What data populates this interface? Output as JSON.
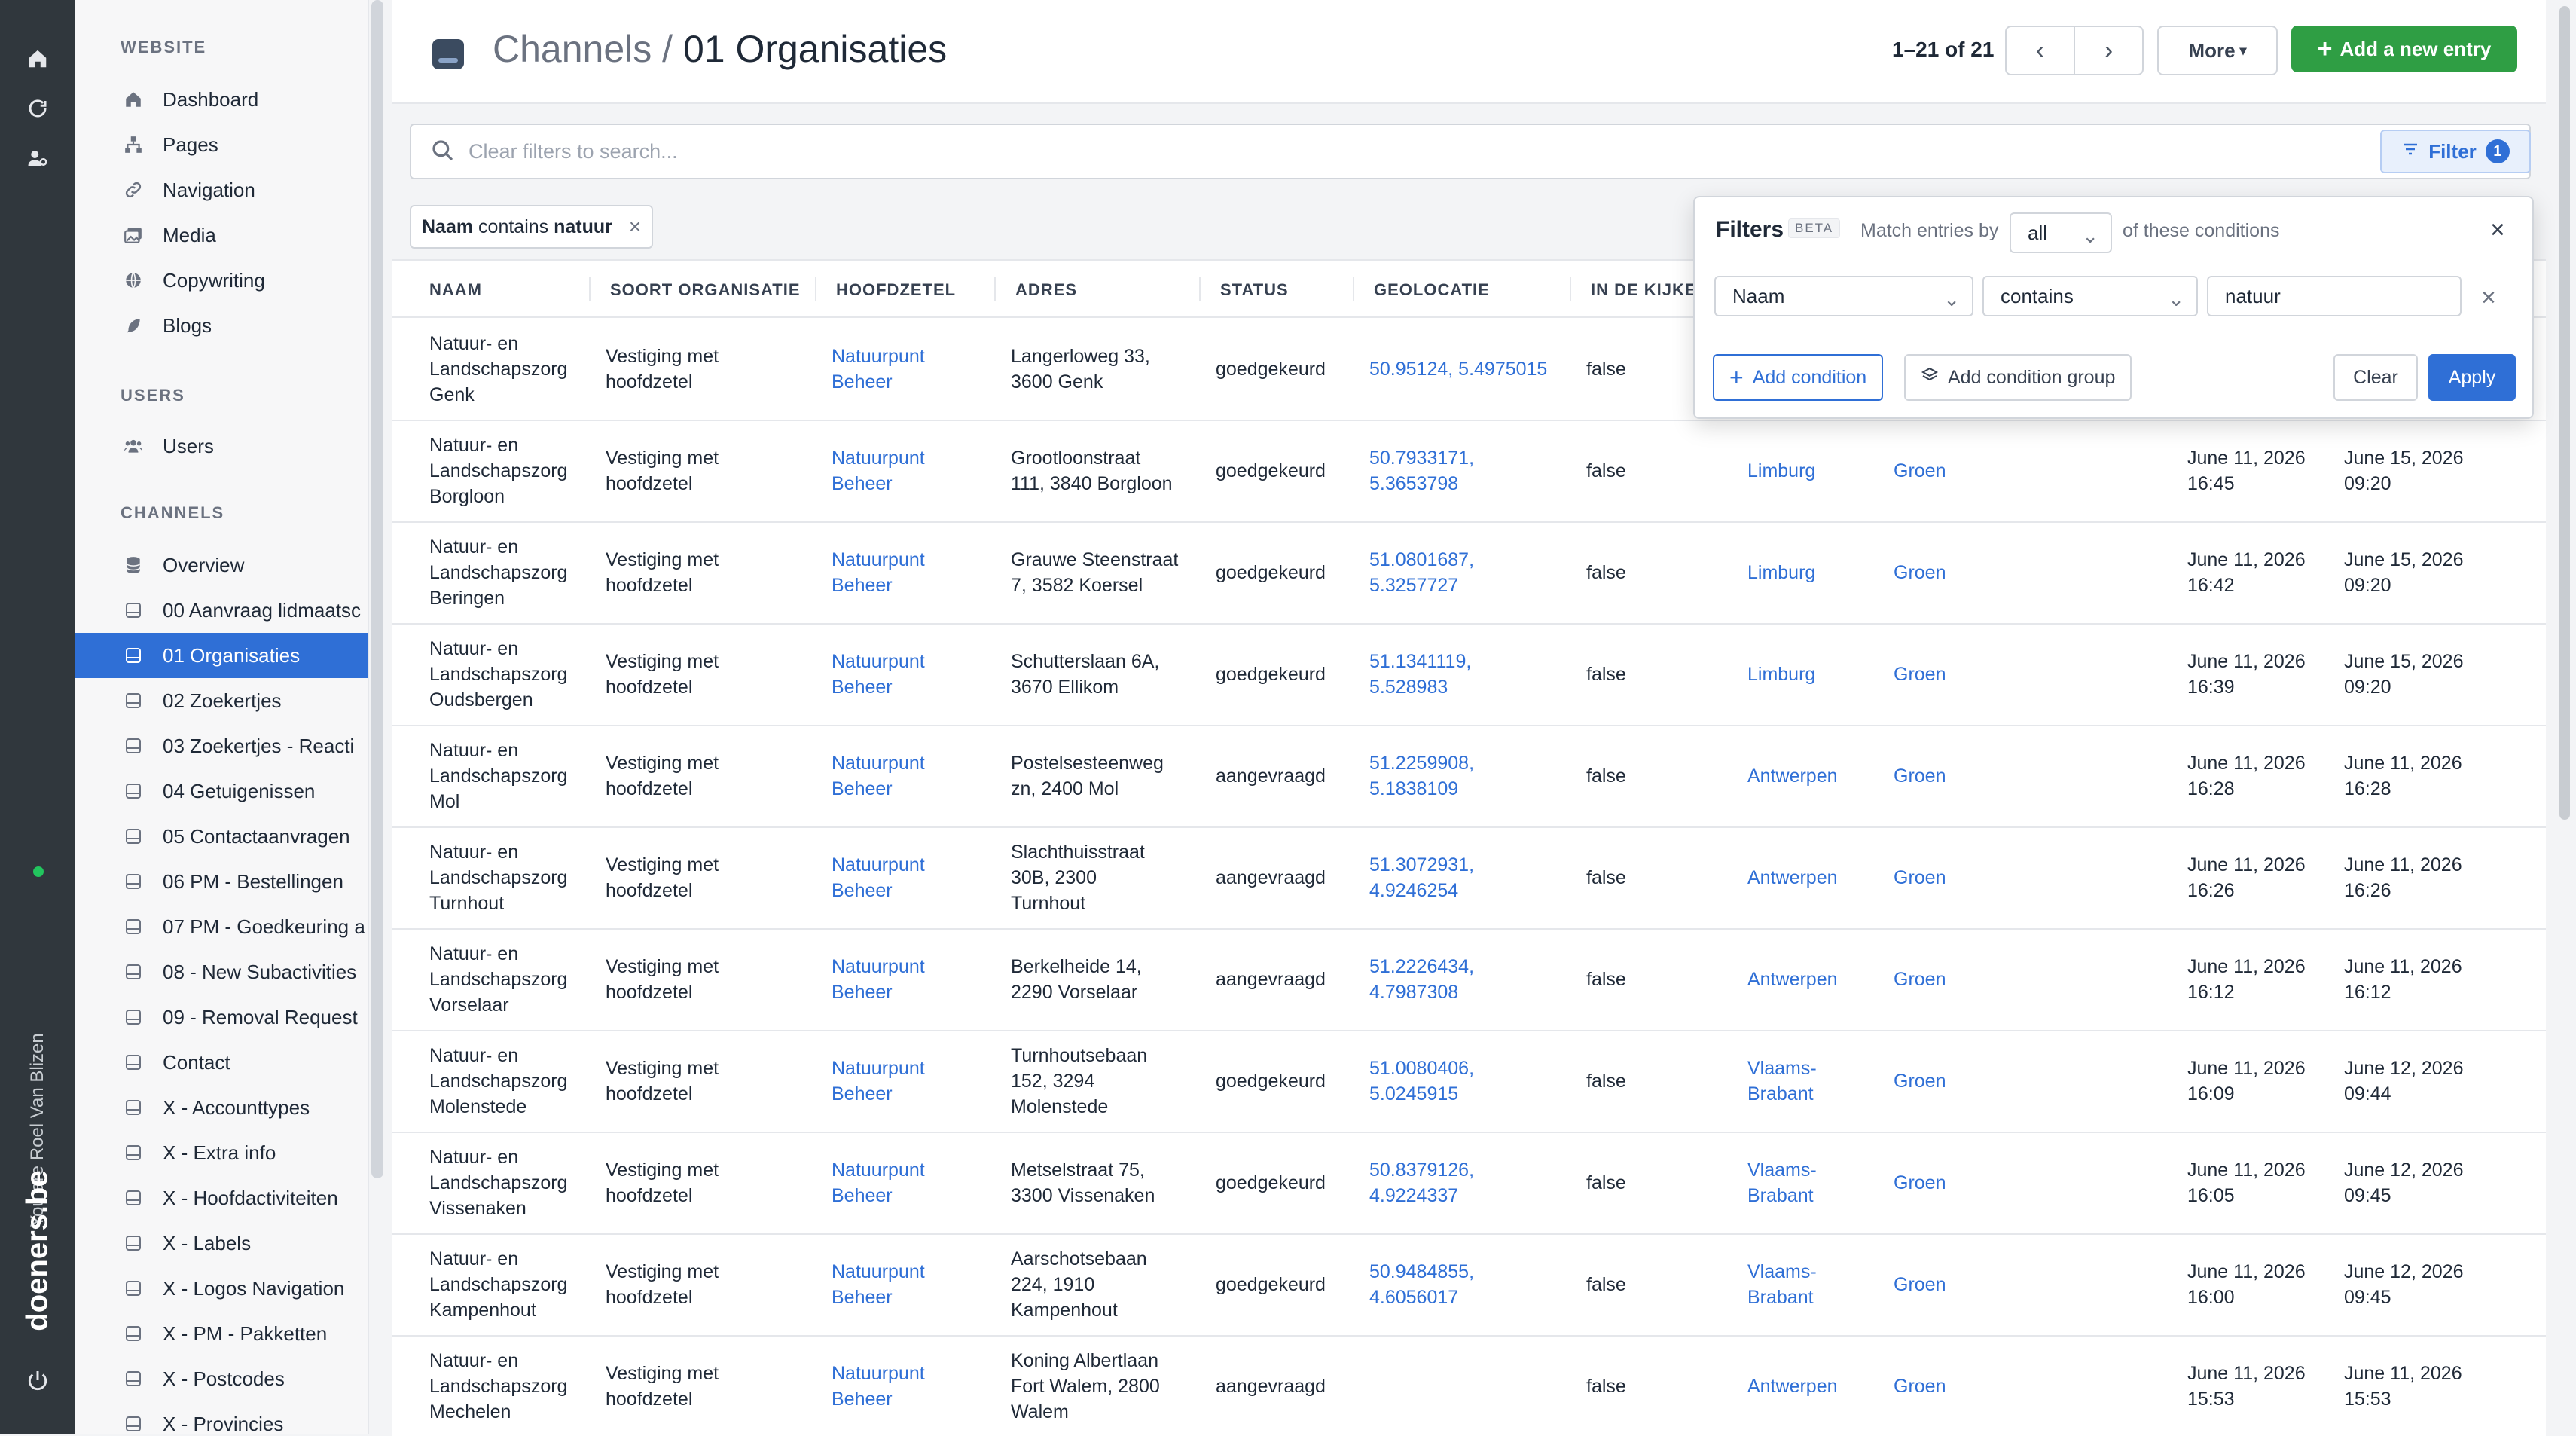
{
  "rail": {
    "user_text": "You are Roel Van Blizen",
    "brand": "doeners.be"
  },
  "sidebar": {
    "sections": [
      {
        "title": "WEBSITE",
        "items": [
          {
            "label": "Dashboard",
            "icon": "home-icon"
          },
          {
            "label": "Pages",
            "icon": "sitemap-icon"
          },
          {
            "label": "Navigation",
            "icon": "link-icon"
          },
          {
            "label": "Media",
            "icon": "images-icon"
          },
          {
            "label": "Copywriting",
            "icon": "globe-icon"
          },
          {
            "label": "Blogs",
            "icon": "feather-icon"
          }
        ]
      },
      {
        "title": "USERS",
        "items": [
          {
            "label": "Users",
            "icon": "users-icon"
          }
        ]
      },
      {
        "title": "CHANNELS",
        "items": [
          {
            "label": "Overview",
            "icon": "database-icon"
          },
          {
            "label": "00 Aanvraag lidmaatsc",
            "icon": "channel-icon"
          },
          {
            "label": "01 Organisaties",
            "icon": "channel-icon",
            "active": true
          },
          {
            "label": "02 Zoekertjes",
            "icon": "channel-icon"
          },
          {
            "label": "03 Zoekertjes - Reacti",
            "icon": "channel-icon"
          },
          {
            "label": "04 Getuigenissen",
            "icon": "channel-icon"
          },
          {
            "label": "05 Contactaanvragen",
            "icon": "channel-icon"
          },
          {
            "label": "06 PM - Bestellingen",
            "icon": "channel-icon"
          },
          {
            "label": "07 PM - Goedkeuring a",
            "icon": "channel-icon"
          },
          {
            "label": "08 - New Subactivities",
            "icon": "channel-icon"
          },
          {
            "label": "09 - Removal Request",
            "icon": "channel-icon"
          },
          {
            "label": "Contact",
            "icon": "channel-icon"
          },
          {
            "label": "X - Accounttypes",
            "icon": "channel-icon"
          },
          {
            "label": "X - Extra info",
            "icon": "channel-icon"
          },
          {
            "label": "X - Hoofdactiviteiten",
            "icon": "channel-icon"
          },
          {
            "label": "X - Labels",
            "icon": "channel-icon"
          },
          {
            "label": "X - Logos Navigation",
            "icon": "channel-icon"
          },
          {
            "label": "X - PM - Pakketten",
            "icon": "channel-icon"
          },
          {
            "label": "X - Postcodes",
            "icon": "channel-icon"
          },
          {
            "label": "X - Provincies",
            "icon": "channel-icon"
          }
        ]
      }
    ]
  },
  "header": {
    "crumb": "Channels",
    "sep": " / ",
    "title": "01 Organisaties",
    "pager_count": "1–21 of 21",
    "more_label": "More",
    "add_label": "Add a new entry"
  },
  "search": {
    "placeholder": "Clear filters to search...",
    "filter_label": "Filter",
    "filter_count": "1"
  },
  "chip": {
    "field": "Naam",
    "op": " contains ",
    "value": "natuur"
  },
  "filters": {
    "title": "Filters",
    "beta": "BETA",
    "match_label": "Match entries by",
    "match_value": "all",
    "of_label": "of these conditions",
    "condition": {
      "field": "Naam",
      "operator": "contains",
      "value": "natuur"
    },
    "add_condition": "Add condition",
    "add_group": "Add condition group",
    "clear": "Clear",
    "apply": "Apply"
  },
  "table": {
    "columns": [
      "NAAM",
      "SOORT ORGANISATIE",
      "HOOFDZETEL",
      "ADRES",
      "STATUS",
      "GEOLOCATIE",
      "IN DE KIJKER"
    ],
    "rows": [
      {
        "naam": [
          "Natuur- en",
          "Landschapszorg",
          "Genk"
        ],
        "soort": [
          "Vestiging met",
          "hoofdzetel"
        ],
        "hoofdzetel": [
          "Natuurpunt",
          "Beheer"
        ],
        "adres": [
          "Langerloweg 33,",
          "3600 Genk"
        ],
        "status": "goedgekeurd",
        "geo": [
          "50.95124, 5.4975015"
        ],
        "kijker": "false",
        "provincie": [],
        "thema": "",
        "d1": [],
        "d2": []
      },
      {
        "naam": [
          "Natuur- en",
          "Landschapszorg",
          "Borgloon"
        ],
        "soort": [
          "Vestiging met",
          "hoofdzetel"
        ],
        "hoofdzetel": [
          "Natuurpunt",
          "Beheer"
        ],
        "adres": [
          "Grootloonstraat",
          "111, 3840 Borgloon"
        ],
        "status": "goedgekeurd",
        "geo": [
          "50.7933171,",
          "5.3653798"
        ],
        "kijker": "false",
        "provincie": [
          "Limburg"
        ],
        "thema": "Groen",
        "d1": [
          "June 11, 2026",
          "16:45"
        ],
        "d2": [
          "June 15, 2026",
          "09:20"
        ]
      },
      {
        "naam": [
          "Natuur- en",
          "Landschapszorg",
          "Beringen"
        ],
        "soort": [
          "Vestiging met",
          "hoofdzetel"
        ],
        "hoofdzetel": [
          "Natuurpunt",
          "Beheer"
        ],
        "adres": [
          "Grauwe Steenstraat",
          "7, 3582 Koersel"
        ],
        "status": "goedgekeurd",
        "geo": [
          "51.0801687,",
          "5.3257727"
        ],
        "kijker": "false",
        "provincie": [
          "Limburg"
        ],
        "thema": "Groen",
        "d1": [
          "June 11, 2026",
          "16:42"
        ],
        "d2": [
          "June 15, 2026",
          "09:20"
        ]
      },
      {
        "naam": [
          "Natuur- en",
          "Landschapszorg",
          "Oudsbergen"
        ],
        "soort": [
          "Vestiging met",
          "hoofdzetel"
        ],
        "hoofdzetel": [
          "Natuurpunt",
          "Beheer"
        ],
        "adres": [
          "Schutterslaan 6A,",
          "3670 Ellikom"
        ],
        "status": "goedgekeurd",
        "geo": [
          "51.1341119,",
          "5.528983"
        ],
        "kijker": "false",
        "provincie": [
          "Limburg"
        ],
        "thema": "Groen",
        "d1": [
          "June 11, 2026",
          "16:39"
        ],
        "d2": [
          "June 15, 2026",
          "09:20"
        ]
      },
      {
        "naam": [
          "Natuur- en",
          "Landschapszorg",
          "Mol"
        ],
        "soort": [
          "Vestiging met",
          "hoofdzetel"
        ],
        "hoofdzetel": [
          "Natuurpunt",
          "Beheer"
        ],
        "adres": [
          "Postelsesteenweg",
          "zn, 2400 Mol"
        ],
        "status": "aangevraagd",
        "geo": [
          "51.2259908,",
          "5.1838109"
        ],
        "kijker": "false",
        "provincie": [
          "Antwerpen"
        ],
        "thema": "Groen",
        "d1": [
          "June 11, 2026",
          "16:28"
        ],
        "d2": [
          "June 11, 2026",
          "16:28"
        ]
      },
      {
        "naam": [
          "Natuur- en",
          "Landschapszorg",
          "Turnhout"
        ],
        "soort": [
          "Vestiging met",
          "hoofdzetel"
        ],
        "hoofdzetel": [
          "Natuurpunt",
          "Beheer"
        ],
        "adres": [
          "Slachthuisstraat",
          "30B, 2300",
          "Turnhout"
        ],
        "status": "aangevraagd",
        "geo": [
          "51.3072931,",
          "4.9246254"
        ],
        "kijker": "false",
        "provincie": [
          "Antwerpen"
        ],
        "thema": "Groen",
        "d1": [
          "June 11, 2026",
          "16:26"
        ],
        "d2": [
          "June 11, 2026",
          "16:26"
        ]
      },
      {
        "naam": [
          "Natuur- en",
          "Landschapszorg",
          "Vorselaar"
        ],
        "soort": [
          "Vestiging met",
          "hoofdzetel"
        ],
        "hoofdzetel": [
          "Natuurpunt",
          "Beheer"
        ],
        "adres": [
          "Berkelheide 14,",
          "2290 Vorselaar"
        ],
        "status": "aangevraagd",
        "geo": [
          "51.2226434,",
          "4.7987308"
        ],
        "kijker": "false",
        "provincie": [
          "Antwerpen"
        ],
        "thema": "Groen",
        "d1": [
          "June 11, 2026",
          "16:12"
        ],
        "d2": [
          "June 11, 2026",
          "16:12"
        ]
      },
      {
        "naam": [
          "Natuur- en",
          "Landschapszorg",
          "Molenstede"
        ],
        "soort": [
          "Vestiging met",
          "hoofdzetel"
        ],
        "hoofdzetel": [
          "Natuurpunt",
          "Beheer"
        ],
        "adres": [
          "Turnhoutsebaan",
          "152, 3294",
          "Molenstede"
        ],
        "status": "goedgekeurd",
        "geo": [
          "51.0080406,",
          "5.0245915"
        ],
        "kijker": "false",
        "provincie": [
          "Vlaams-",
          "Brabant"
        ],
        "thema": "Groen",
        "d1": [
          "June 11, 2026",
          "16:09"
        ],
        "d2": [
          "June 12, 2026",
          "09:44"
        ]
      },
      {
        "naam": [
          "Natuur- en",
          "Landschapszorg",
          "Vissenaken"
        ],
        "soort": [
          "Vestiging met",
          "hoofdzetel"
        ],
        "hoofdzetel": [
          "Natuurpunt",
          "Beheer"
        ],
        "adres": [
          "Metselstraat 75,",
          "3300 Vissenaken"
        ],
        "status": "goedgekeurd",
        "geo": [
          "50.8379126,",
          "4.9224337"
        ],
        "kijker": "false",
        "provincie": [
          "Vlaams-",
          "Brabant"
        ],
        "thema": "Groen",
        "d1": [
          "June 11, 2026",
          "16:05"
        ],
        "d2": [
          "June 12, 2026",
          "09:45"
        ]
      },
      {
        "naam": [
          "Natuur- en",
          "Landschapszorg",
          "Kampenhout"
        ],
        "soort": [
          "Vestiging met",
          "hoofdzetel"
        ],
        "hoofdzetel": [
          "Natuurpunt",
          "Beheer"
        ],
        "adres": [
          "Aarschotsebaan",
          "224, 1910",
          "Kampenhout"
        ],
        "status": "goedgekeurd",
        "geo": [
          "50.9484855,",
          "4.6056017"
        ],
        "kijker": "false",
        "provincie": [
          "Vlaams-",
          "Brabant"
        ],
        "thema": "Groen",
        "d1": [
          "June 11, 2026",
          "16:00"
        ],
        "d2": [
          "June 12, 2026",
          "09:45"
        ]
      },
      {
        "naam": [
          "Natuur- en",
          "Landschapszorg",
          "Mechelen"
        ],
        "soort": [
          "Vestiging met",
          "hoofdzetel"
        ],
        "hoofdzetel": [
          "Natuurpunt",
          "Beheer"
        ],
        "adres": [
          "Koning Albertlaan",
          "Fort Walem, 2800",
          "Walem"
        ],
        "status": "aangevraagd",
        "geo": [],
        "kijker": "false",
        "provincie": [
          "Antwerpen"
        ],
        "thema": "Groen",
        "d1": [
          "June 11, 2026",
          "15:53"
        ],
        "d2": [
          "June 11, 2026",
          "15:53"
        ]
      }
    ]
  }
}
